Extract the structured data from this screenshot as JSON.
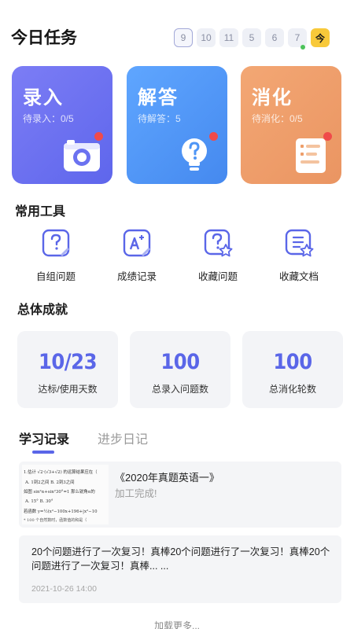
{
  "header": {
    "title": "今日任务",
    "days": [
      "9",
      "10",
      "11",
      "5",
      "6",
      "7"
    ],
    "today_label": "今"
  },
  "task_cards": [
    {
      "title": "录入",
      "subtitle": "待录入：0/5",
      "icon": "camera-icon",
      "color": "#6b72f0"
    },
    {
      "title": "解答",
      "subtitle": "待解答：5",
      "icon": "lightbulb-question-icon",
      "color": "#4f96f6"
    },
    {
      "title": "消化",
      "subtitle": "待消化：0/5",
      "icon": "notepad-icon",
      "color": "#ee9e6a"
    }
  ],
  "tools": {
    "title": "常用工具",
    "items": [
      {
        "label": "自组问题",
        "icon": "question-doc-icon"
      },
      {
        "label": "成绩记录",
        "icon": "score-record-icon"
      },
      {
        "label": "收藏问题",
        "icon": "favorite-question-icon"
      },
      {
        "label": "收藏文档",
        "icon": "favorite-document-icon"
      }
    ]
  },
  "achievements": {
    "title": "总体成就",
    "stats": [
      {
        "value": "10/23",
        "label": "达标/使用天数"
      },
      {
        "value": "100",
        "label": "总录入问题数"
      },
      {
        "value": "100",
        "label": "总消化轮数"
      }
    ]
  },
  "tabs": {
    "items": [
      "学习记录",
      "进步日记"
    ],
    "active": 0
  },
  "records": [
    {
      "title": "《2020年真题英语一》",
      "status": "加工完成!",
      "thumb_lines": [
        "1.估计 √2·(√3+√2) 的运算结果应在（",
        "A. 1到2之间    B. 2到3之间",
        "如图 sin²α+sin²30°=1 那么锐角α的",
        "A. 15°         B. 30°",
        "若函数 y=½(x²−100x+196+|x²−10",
        "* 100 个自然数时，函数值的和是（"
      ]
    },
    {
      "text": "20个问题进行了一次复习！真棒20个问题进行了一次复习！真棒20个问题进行了一次复习！真棒... ...",
      "time": "2021-10-26  14:00"
    }
  ],
  "load_more": "加载更多..."
}
